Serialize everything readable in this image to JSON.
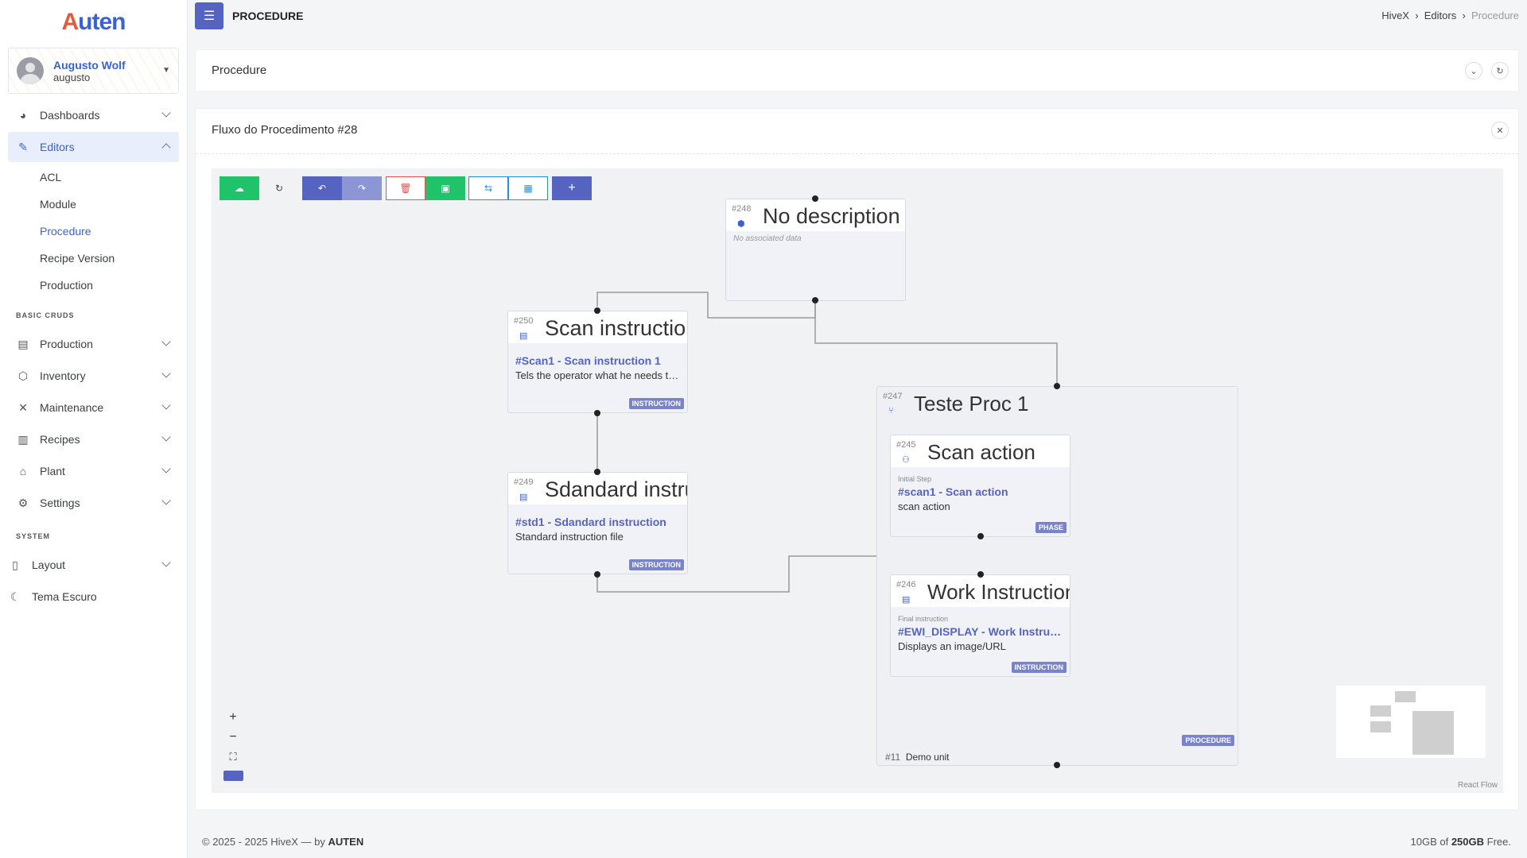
{
  "app": {
    "logo": "Auten",
    "page_title": "PROCEDURE"
  },
  "user": {
    "name": "Augusto Wolf",
    "login": "augusto"
  },
  "sidebar": {
    "dashboards": "Dashboards",
    "editors": "Editors",
    "editors_items": [
      "ACL",
      "Module",
      "Procedure",
      "Recipe Version",
      "Production"
    ],
    "section_basic": "BASIC CRUDS",
    "basic": [
      "Production",
      "Inventory",
      "Maintenance",
      "Recipes",
      "Plant",
      "Settings"
    ],
    "section_system": "SYSTEM",
    "layout": "Layout",
    "dark": "Tema Escuro"
  },
  "breadcrumb": [
    "HiveX",
    "Editors",
    "Procedure"
  ],
  "procedure_card": {
    "title": "Procedure"
  },
  "flow_card": {
    "title": "Fluxo do Procedimento #28"
  },
  "nodes": {
    "n248": {
      "id": "#248",
      "name": "No description",
      "note": "No associated data"
    },
    "n250": {
      "id": "#250",
      "name": "Scan instruction",
      "code": "#Scan1 - Scan instruction 1",
      "desc": "Tels the operator what he needs to do",
      "badge": "INSTRUCTION"
    },
    "n249": {
      "id": "#249",
      "name": "Sdandard instruction",
      "code": "#std1 - Sdandard instruction",
      "desc": "Standard instruction file",
      "badge": "INSTRUCTION"
    },
    "n247": {
      "id": "#247",
      "name": "Teste Proc 1",
      "badge": "PROCEDURE",
      "unit_id": "#11",
      "unit": "Demo unit"
    },
    "n245": {
      "id": "#245",
      "name": "Scan action",
      "step": "Initial Step",
      "code": "#scan1 - Scan action",
      "desc": "scan action",
      "badge": "PHASE"
    },
    "n246": {
      "id": "#246",
      "name": "Work Instruction",
      "step": "Final instruction",
      "code": "#EWI_DISPLAY - Work Instruction",
      "desc": "Displays an image/URL",
      "badge": "INSTRUCTION"
    }
  },
  "attribution": "React Flow",
  "footer": {
    "copy": "© 2025 - 2025 HiveX — by",
    "brand": "AUTEN",
    "storage": "10GB of",
    "total": "250GB",
    "free": "Free."
  }
}
